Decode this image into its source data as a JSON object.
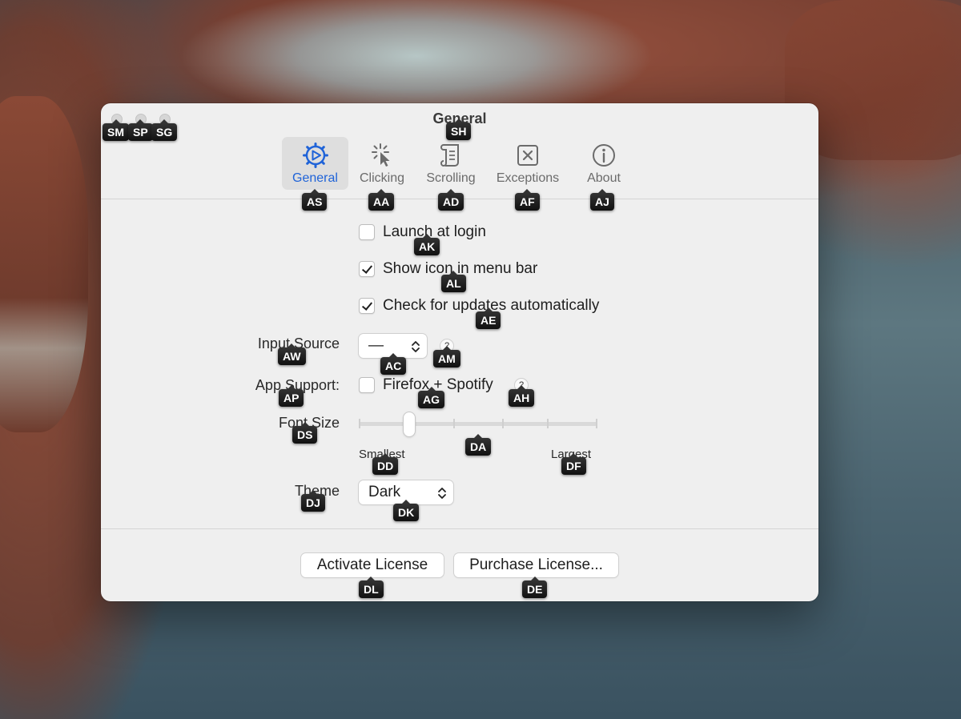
{
  "window": {
    "title": "General"
  },
  "tabs": [
    {
      "label": "General",
      "icon": "gear-play-icon",
      "active": true
    },
    {
      "label": "Clicking",
      "icon": "click-cursor-icon",
      "active": false
    },
    {
      "label": "Scrolling",
      "icon": "scroll-icon",
      "active": false
    },
    {
      "label": "Exceptions",
      "icon": "x-box-icon",
      "active": false
    },
    {
      "label": "About",
      "icon": "info-icon",
      "active": false
    }
  ],
  "settings": {
    "launch_at_login": {
      "label": "Launch at login",
      "checked": false
    },
    "show_icon": {
      "label": "Show icon in menu bar",
      "checked": true
    },
    "check_updates": {
      "label": "Check for updates automatically",
      "checked": true
    },
    "input_source": {
      "label": "Input Source",
      "value": "—",
      "help": "?"
    },
    "app_support": {
      "label": "App Support:",
      "option_label": "Firefox + Spotify",
      "checked": false,
      "help": "?"
    },
    "font_size": {
      "label": "Font Size",
      "min_label": "Smallest",
      "max_label": "Largest",
      "steps": 6,
      "value_step": 1
    },
    "theme": {
      "label": "Theme",
      "value": "Dark"
    }
  },
  "buttons": {
    "activate": "Activate License",
    "purchase": "Purchase License..."
  },
  "hints": {
    "SM": "SM",
    "SP": "SP",
    "SG": "SG",
    "SH": "SH",
    "AS": "AS",
    "AA": "AA",
    "AD": "AD",
    "AF": "AF",
    "AJ": "AJ",
    "AK": "AK",
    "AL": "AL",
    "AE": "AE",
    "AW": "AW",
    "AC": "AC",
    "AM": "AM",
    "AP": "AP",
    "AG": "AG",
    "AH": "AH",
    "DS": "DS",
    "DA": "DA",
    "DD": "DD",
    "DF": "DF",
    "DJ": "DJ",
    "DK": "DK",
    "DL": "DL",
    "DE": "DE"
  },
  "colors": {
    "accent": "#1f63d8",
    "hint_badge": "#1a1a1a"
  }
}
